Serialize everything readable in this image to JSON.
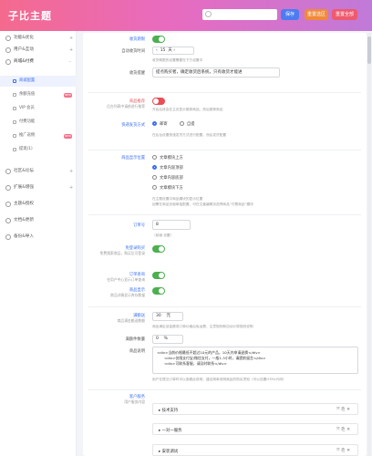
{
  "header": {
    "brand": "子比主题",
    "search_placeholder": "",
    "btn_save": "保存",
    "btn_reset_section": "重置选区",
    "btn_reset_all": "重置全部"
  },
  "sidebar": {
    "items": [
      {
        "label": "功能&优化",
        "arrow": "+"
      },
      {
        "label": "用户&互动",
        "arrow": "+"
      },
      {
        "label": "商城&付费",
        "arrow": "-"
      },
      {
        "label": "商城配置",
        "arrow": ""
      },
      {
        "label": "余额充值",
        "badge": "NEW"
      },
      {
        "label": "VIP 会员"
      },
      {
        "label": "付费功能"
      },
      {
        "label": "推广返佣",
        "badge": "NEW"
      },
      {
        "label": "提现(1)"
      },
      {
        "label": "社区&论坛",
        "arrow": "+"
      },
      {
        "label": "扩展&增强",
        "arrow": "+"
      },
      {
        "label": "主题&授权"
      },
      {
        "label": "文档&更新"
      },
      {
        "label": "备份&导入"
      }
    ]
  },
  "form": {
    "f1_label": "收货期限",
    "f2_label": "自动收货时间",
    "f2_value": "15",
    "f2_unit": "天",
    "f2_desc": "收货期限的设置需要在下方设置中",
    "f3_label": "收货提醒",
    "f3_value": "提点购买者，确定收货后系统，只有收货才能进",
    "f4_label": "商品推荐",
    "f4_hint": "后台列表中请前进行推荐",
    "f4_desc": "开启后将会在主页显示推荐商品，然后推荐商品",
    "f5_label": "快递发货方式",
    "f5_opt1": "邮寄",
    "f5_opt2": "自提",
    "f5_desc": "在后台设置快递发货方式进行配置，然后发货配置",
    "f6_label": "商品显示位置",
    "f6_opts": [
      "文章模块上方",
      "文章内容顶部",
      "文章内容底部",
      "文章模块下方"
    ],
    "f6_desc1": "在主题设置中商品模块的显示位置",
    "f6_desc2": "如需在商品页面单独配置，可在文章编辑页选择商品“付费商品”模块",
    "f7_label": "订单号",
    "f7_value": "8",
    "f7_desc": "（前缀 设置）",
    "f8_label": "免登录购买",
    "f8_hint": "免费搜索商品，购买后可登录",
    "f9_label": "订单查询",
    "f9_hint": "在用户中心显示订单查询",
    "f10_label": "商品显示",
    "f10_hint": "商品详情显示库存数量",
    "f11_label": "满额送",
    "f11_hint": "商品满金额送数额",
    "f11_value": "30",
    "f11_unit": "元",
    "f11_desc": "商品满足该金额或订单价格后免运费，注意规则和自动计算规则说明",
    "f12_label": "满额件数量",
    "f12_value": "0",
    "f12_unit": "%",
    "f13_label": "商品说明",
    "f13_lines": [
      "<div>当前价格最低不超过10元的产品，10天内申请退换</div>",
      "<div>仅限支付宝/微信支付，一般1-3小时，请提前留言</div>",
      "<div>可联系客服，请及时联系</div>"
    ],
    "f13_desc": "用户在提交订单时可以查看此说明，建议简单说明商品的购买须知（可以设置HTML代码）",
    "f14_label": "客户服务",
    "f14_hint": "用户服务内容",
    "services": [
      "技术支持",
      "一对一服务",
      "安装调试"
    ]
  }
}
